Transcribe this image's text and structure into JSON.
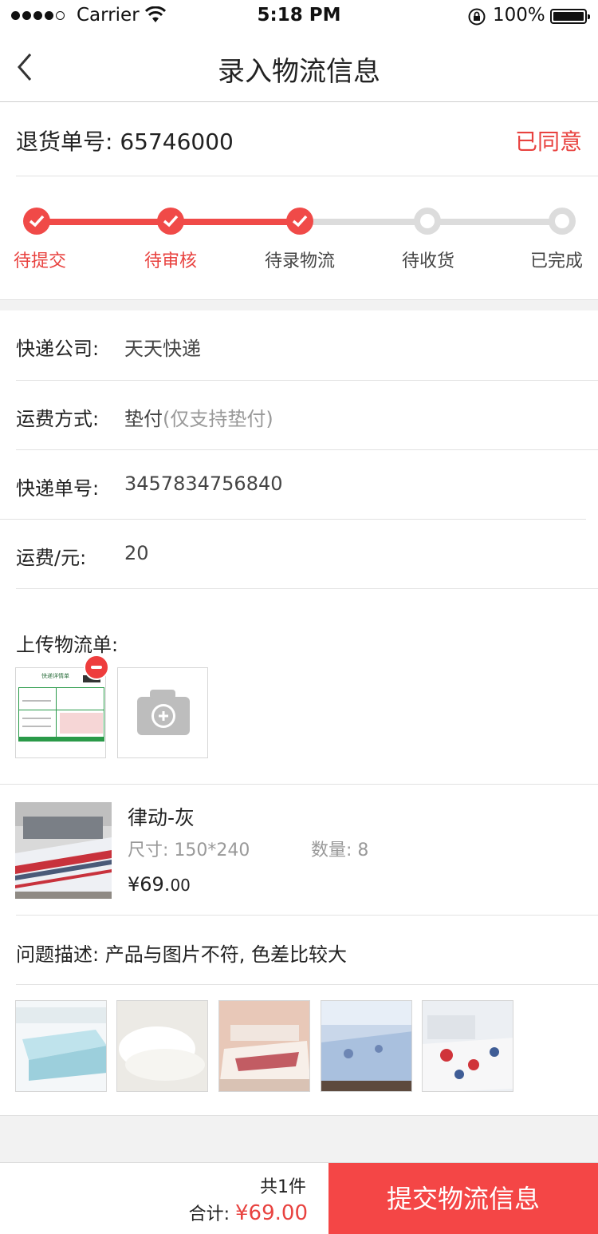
{
  "status_bar": {
    "carrier": "Carrier",
    "time": "5:18 PM",
    "battery": "100%",
    "icons": [
      "signal-dots-icon",
      "wifi-icon",
      "rotation-lock-icon",
      "battery-icon"
    ]
  },
  "nav": {
    "title": "录入物流信息",
    "back_icon": "chevron-left-icon"
  },
  "order": {
    "label": "退货单号: 65746000",
    "status": "已同意"
  },
  "progress": {
    "completed_steps": 3,
    "steps": [
      {
        "label": "待提交",
        "state": "done"
      },
      {
        "label": "待审核",
        "state": "done"
      },
      {
        "label": "待录物流",
        "state": "done"
      },
      {
        "label": "待收货",
        "state": "pending"
      },
      {
        "label": "已完成",
        "state": "pending"
      }
    ]
  },
  "form": {
    "courier": {
      "label": "快递公司:",
      "value": "天天快递"
    },
    "shipping_method": {
      "label": "运费方式:",
      "value": "垫付",
      "hint": "(仅支持垫付)"
    },
    "tracking": {
      "label": "快递单号:",
      "value": "3457834756840"
    },
    "fee": {
      "label": "运费/元:",
      "value": "20"
    }
  },
  "upload": {
    "title": "上传物流单:",
    "slip_title": "快递详情单",
    "icons": [
      "remove-icon",
      "camera-add-icon"
    ]
  },
  "product": {
    "name": "律动-灰",
    "size": "尺寸: 150*240",
    "quantity": "数量: 8",
    "price_main": "¥69.",
    "price_cents": "00"
  },
  "problem": {
    "text": "问题描述: 产品与图片不符, 色差比较大"
  },
  "footer": {
    "count": "共1件",
    "total_label": "合计:",
    "total_amount": "¥69.00",
    "submit": "提交物流信息"
  },
  "colors": {
    "accent": "#f44646",
    "status_red": "#e8423f",
    "inactive": "#dcdcdc",
    "band": "#f2f2f2"
  }
}
